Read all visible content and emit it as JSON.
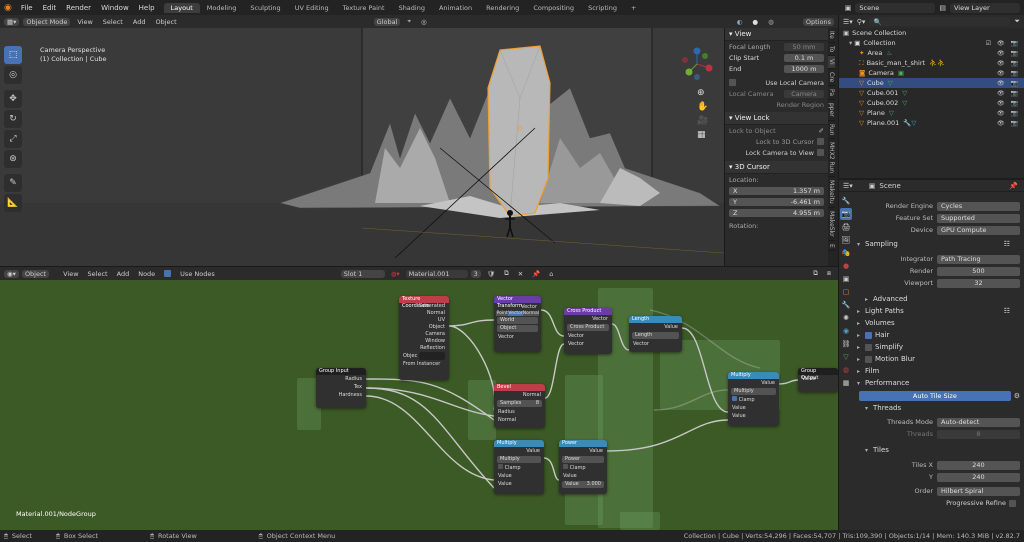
{
  "topbar": {
    "menu": [
      "File",
      "Edit",
      "Render",
      "Window",
      "Help"
    ],
    "workspaces": [
      "Layout",
      "Modeling",
      "Sculpting",
      "UV Editing",
      "Texture Paint",
      "Shading",
      "Animation",
      "Rendering",
      "Compositing",
      "Scripting"
    ],
    "add_tab": "+",
    "scene": "Scene",
    "view_layer": "View Layer"
  },
  "viewport_header": {
    "mode": "Object Mode",
    "menus": [
      "View",
      "Select",
      "Add",
      "Object"
    ],
    "orientation": "Global",
    "options": "Options"
  },
  "viewport": {
    "info_line1": "Camera Perspective",
    "info_line2": "(1) Collection | Cube"
  },
  "npanel": {
    "view_title": "View",
    "focal_length_label": "Focal Length",
    "focal_length": "50 mm",
    "clip_start_label": "Clip Start",
    "clip_start": "0.1 m",
    "end_label": "End",
    "end": "1000 m",
    "use_local_camera": "Use Local Camera",
    "local_camera_label": "Local Camera",
    "local_camera": "Camera",
    "render_region": "Render Region",
    "view_lock_title": "View Lock",
    "lock_to_object": "Lock to Object",
    "lock_to_3d_cursor": "Lock to 3D Cursor",
    "lock_camera_to_view": "Lock Camera to View",
    "cursor_title": "3D Cursor",
    "location_label": "Location:",
    "x_label": "X",
    "x": "1.357 m",
    "y_label": "Y",
    "y": "-6.461 m",
    "z_label": "Z",
    "z": "4.955 m",
    "rotation_label": "Rotation:",
    "tabs": [
      "Ite",
      "To",
      "Vi",
      "Cre",
      "Pa",
      "pper",
      "Run",
      "MHX2 Run",
      "Makeitu",
      "MakeSkr",
      "E"
    ]
  },
  "outliner": {
    "root": "Scene Collection",
    "collection": "Collection",
    "items": [
      {
        "name": "Area",
        "selected": false
      },
      {
        "name": "Basic_man_t_shirt",
        "selected": false
      },
      {
        "name": "Camera",
        "selected": false
      },
      {
        "name": "Cube",
        "selected": true
      },
      {
        "name": "Cube.001",
        "selected": false
      },
      {
        "name": "Cube.002",
        "selected": false
      },
      {
        "name": "Plane",
        "selected": false
      },
      {
        "name": "Plane.001",
        "selected": false
      }
    ]
  },
  "properties": {
    "scene": "Scene",
    "render_engine_label": "Render Engine",
    "render_engine": "Cycles",
    "feature_set_label": "Feature Set",
    "feature_set": "Supported",
    "device_label": "Device",
    "device": "GPU Compute",
    "sampling": "Sampling",
    "integrator_label": "Integrator",
    "integrator": "Path Tracing",
    "render_label": "Render",
    "render": "500",
    "viewport_label": "Viewport",
    "viewport": "32",
    "advanced": "Advanced",
    "light_paths": "Light Paths",
    "volumes": "Volumes",
    "hair": "Hair",
    "simplify": "Simplify",
    "motion_blur": "Motion Blur",
    "film": "Film",
    "performance": "Performance",
    "auto_tile_size": "Auto Tile Size",
    "threads": "Threads",
    "threads_mode_label": "Threads Mode",
    "threads_mode": "Auto-detect",
    "threads_count_label": "Threads",
    "threads_count": "8",
    "tiles": "Tiles",
    "tiles_x_label": "Tiles X",
    "tiles_x": "240",
    "tiles_y_label": "Y",
    "tiles_y": "240",
    "order_label": "Order",
    "order": "Hilbert Spiral",
    "progressive_refine": "Progressive Refine"
  },
  "node_header": {
    "type": "Object",
    "menus": [
      "View",
      "Select",
      "Add",
      "Node"
    ],
    "use_nodes": "Use Nodes",
    "slot": "Slot 1",
    "material": "Material.001",
    "users": "3"
  },
  "node_editor": {
    "breadcrumb": "Material.001/NodeGroup",
    "nodes": {
      "texcoord": {
        "title": "Texture Coordinate",
        "outputs": [
          "Generated",
          "Normal",
          "UV",
          "Object",
          "Camera",
          "Window",
          "Reflection"
        ],
        "object_label": "Objec",
        "from_instancer": "From Instancer"
      },
      "group_input": {
        "title": "Group Input",
        "outputs": [
          "Radius",
          "Tex",
          "Hardness"
        ]
      },
      "vector_transform": {
        "title": "Vector Transform",
        "out": "Vector",
        "tabs": [
          "Point",
          "Vector",
          "Normal"
        ],
        "from": "World",
        "to": "Object",
        "in": "Vector"
      },
      "cross_product": {
        "title": "Cross Product",
        "out": "Vector",
        "op": "Cross Product",
        "in1": "Vector",
        "in2": "Vector"
      },
      "length": {
        "title": "Length",
        "out": "Value",
        "op": "Length",
        "in": "Vector"
      },
      "bevel": {
        "title": "Bevel",
        "out": "Normal",
        "samples": "Samples",
        "samples_val": "8",
        "in1": "Radius",
        "in2": "Normal"
      },
      "multiply1": {
        "title": "Multiply",
        "out": "Value",
        "op": "Multiply",
        "clamp": "Clamp",
        "in1": "Value",
        "in2": "Value"
      },
      "power": {
        "title": "Power",
        "out": "Value",
        "op": "Power",
        "clamp": "Clamp",
        "in1": "Value",
        "in2": "Value",
        "in2_val": "3.000"
      },
      "multiply2": {
        "title": "Multiply",
        "out": "Value",
        "op": "Multiply",
        "clamp": "Clamp",
        "in1": "Value",
        "in2": "Value"
      },
      "group_output": {
        "title": "Group Output",
        "in": "Value"
      }
    }
  },
  "statusbar": {
    "select": "Select",
    "box_select": "Box Select",
    "rotate_view": "Rotate View",
    "context_menu": "Object Context Menu",
    "stats": "Collection | Cube | Verts:54,296 | Faces:54,707 | Tris:109,390 | Objects:1/14 | Mem: 140.3 MiB | v2.82.7"
  },
  "colors": {
    "accent": "#4772b3",
    "node_bg": "#3c5a25",
    "selection_outline": "#f0a030"
  }
}
